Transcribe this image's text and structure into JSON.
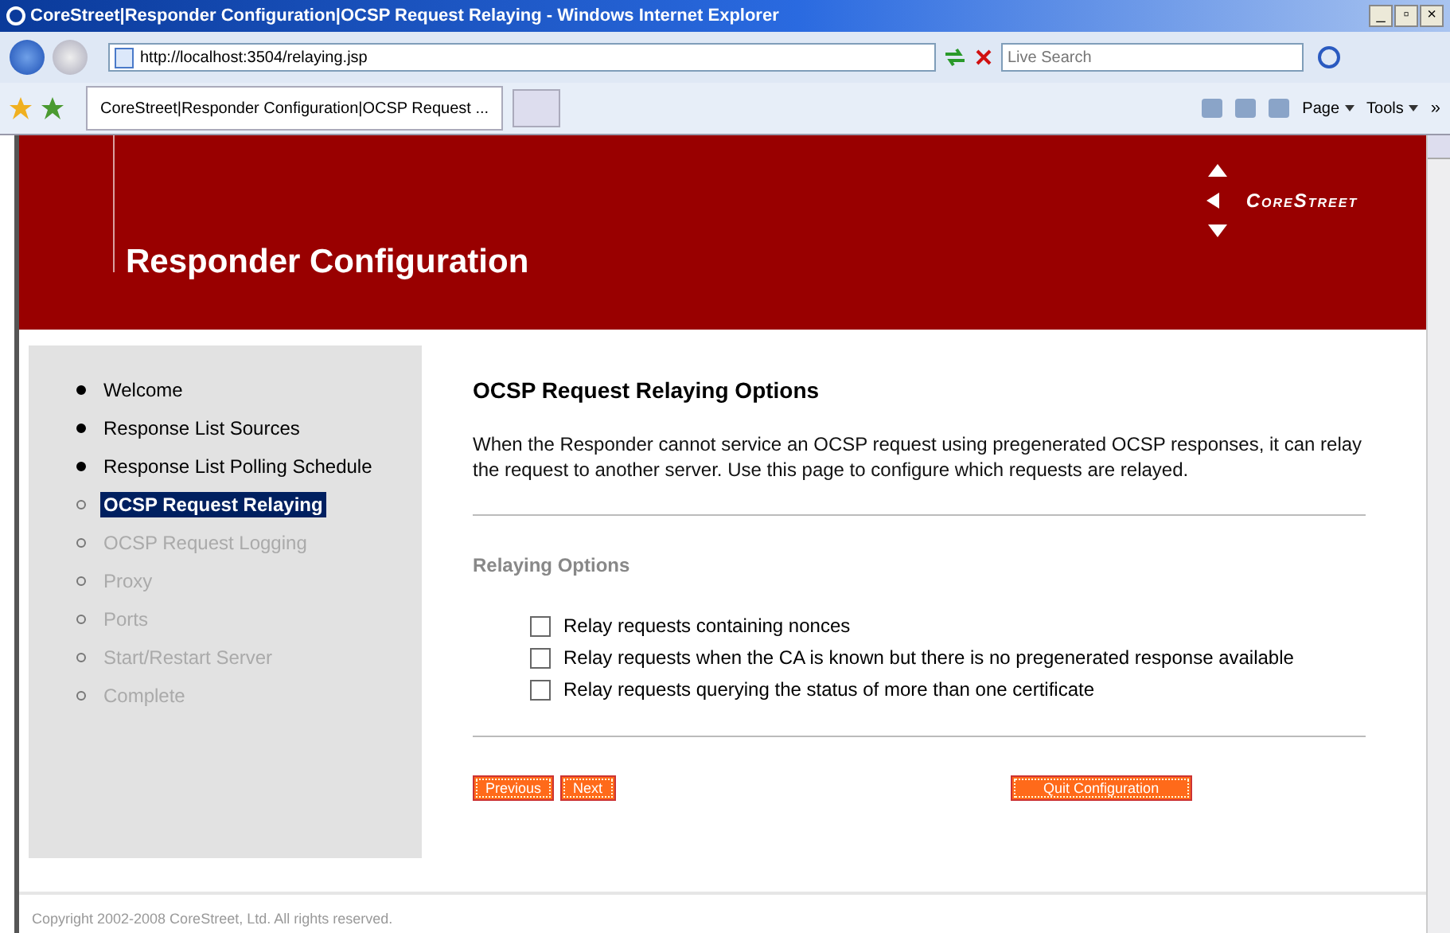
{
  "window": {
    "title": "CoreStreet|Responder Configuration|OCSP Request Relaying - Windows Internet Explorer",
    "controls": [
      "_",
      "▫",
      "×"
    ]
  },
  "address_bar": {
    "url": "http://localhost:3504/relaying.jsp",
    "search_placeholder": "Live Search"
  },
  "tab": {
    "label": "CoreStreet|Responder Configuration|OCSP Request ..."
  },
  "command_bar": {
    "items": [
      {
        "label": "Page"
      },
      {
        "label": "Tools"
      }
    ],
    "overflow": "»"
  },
  "header": {
    "title": "Responder Configuration",
    "logo": "CoreStreet"
  },
  "sidebar": {
    "items": [
      {
        "label": "Welcome",
        "done": true,
        "selected": false
      },
      {
        "label": "Response List Sources",
        "done": true,
        "selected": false
      },
      {
        "label": "Response List Polling Schedule",
        "done": true,
        "selected": false
      },
      {
        "label": "OCSP Request Relaying",
        "done": false,
        "selected": true
      },
      {
        "label": "OCSP Request Logging",
        "done": false,
        "selected": false
      },
      {
        "label": "Proxy",
        "done": false,
        "selected": false
      },
      {
        "label": "Ports",
        "done": false,
        "selected": false
      },
      {
        "label": "Start/Restart Server",
        "done": false,
        "selected": false
      },
      {
        "label": "Complete",
        "done": false,
        "selected": false
      }
    ]
  },
  "content": {
    "heading": "OCSP Request Relaying Options",
    "description": "When the Responder cannot service an OCSP request using pregenerated OCSP responses, it can relay the request to another server. Use this page to configure which requests are relayed.",
    "section": "Relaying Options",
    "options": [
      {
        "label": "Relay requests containing nonces",
        "checked": false
      },
      {
        "label": "Relay requests when the CA is known but there is no pregenerated response available",
        "checked": false
      },
      {
        "label": "Relay requests querying the status of more than one certificate",
        "checked": false
      }
    ],
    "buttons": [
      "Previous",
      "Next"
    ],
    "quit_button": "Quit Configuration"
  },
  "footer": {
    "copyright": "Copyright 2002-2008 CoreStreet, Ltd. All rights reserved."
  }
}
